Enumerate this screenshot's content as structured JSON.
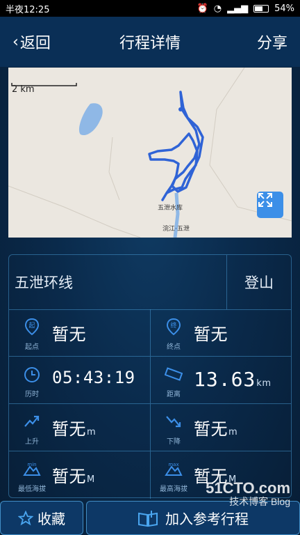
{
  "status_bar": {
    "time": "半夜12:25",
    "battery": "54%"
  },
  "header": {
    "back_label": "返回",
    "title": "行程详情",
    "share_label": "分享"
  },
  "map": {
    "scale": "2 km",
    "place1": "五泄水库",
    "place2": "浣江·五泄"
  },
  "route": {
    "name": "五泄环线",
    "type": "登山"
  },
  "stats": {
    "start": {
      "caption": "起点",
      "value": "暂无"
    },
    "end": {
      "caption": "终点",
      "value": "暂无"
    },
    "duration": {
      "caption": "历时",
      "value": "05:43:19"
    },
    "distance": {
      "caption": "距离",
      "value": "13.63",
      "unit": "km"
    },
    "ascent": {
      "caption": "上升",
      "value": "暂无",
      "unit": "m"
    },
    "descent": {
      "caption": "下降",
      "value": "暂无",
      "unit": "m"
    },
    "min_alt": {
      "caption": "最低海拔",
      "value": "暂无",
      "unit": "M"
    },
    "max_alt": {
      "caption": "最高海拔",
      "value": "暂无",
      "unit": "M"
    }
  },
  "bottom": {
    "collect_label": "收藏",
    "join_label": "加入参考行程"
  },
  "watermark": {
    "main": "51CTO.com",
    "sub": "技术博客 Blog"
  },
  "colors": {
    "accent": "#3c8fe8",
    "route_line": "#2f63d6"
  }
}
